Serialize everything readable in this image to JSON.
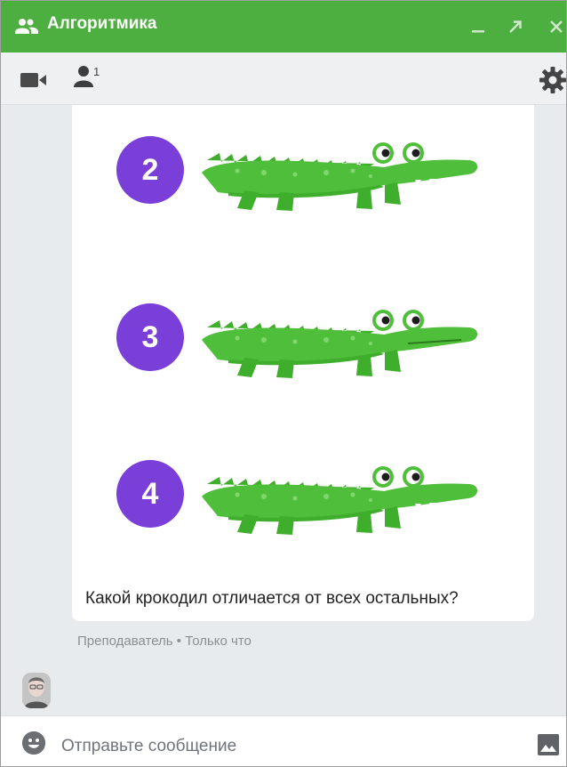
{
  "window": {
    "title": "Алгоритмика"
  },
  "toolbar": {
    "participants_count": "1",
    "icons": [
      "video-icon",
      "people-icon",
      "gear-icon"
    ]
  },
  "message": {
    "numbers": [
      "2",
      "3",
      "4"
    ],
    "text": "Какой крокодил отличается от всех остальных?",
    "author": "Преподаватель",
    "separator": " • ",
    "time": "Только что"
  },
  "composer": {
    "placeholder": "Отправьте сообщение"
  },
  "colors": {
    "title_bar": "#4caf3f",
    "badge": "#7a3fd8",
    "crocodile": "#4fbe3a"
  }
}
